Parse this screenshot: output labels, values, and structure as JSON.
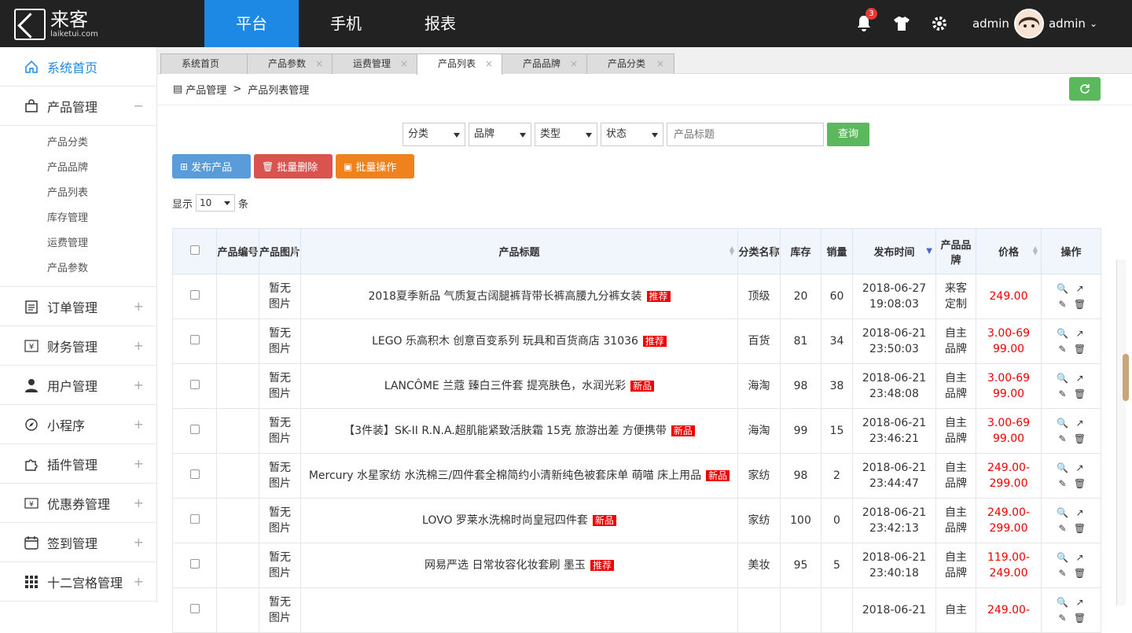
{
  "brand": {
    "cn": "来客",
    "en": "laiketui.com"
  },
  "nav": [
    "平台",
    "手机",
    "报表"
  ],
  "topright": {
    "badge": "3",
    "user_left": "admin",
    "user_right": "admin"
  },
  "sidebar": {
    "home": "系统首页",
    "product": "产品管理",
    "sub": [
      "产品分类",
      "产品品牌",
      "产品列表",
      "库存管理",
      "运费管理",
      "产品参数"
    ],
    "items": [
      "订单管理",
      "财务管理",
      "用户管理",
      "小程序",
      "插件管理",
      "优惠券管理",
      "签到管理",
      "十二宫格管理"
    ]
  },
  "tabs": [
    "系统首页",
    "产品参数",
    "运费管理",
    "产品列表",
    "产品品牌",
    "产品分类"
  ],
  "breadcrumb": {
    "a": "产品管理",
    "sep": ">",
    "b": "产品列表管理"
  },
  "filters": {
    "cat": "分类",
    "brand": "品牌",
    "type": "类型",
    "status": "状态",
    "title_placeholder": "产品标题",
    "query": "查询"
  },
  "actions": {
    "publish": "发布产品",
    "del": "批量删除",
    "batch": "批量操作"
  },
  "show": {
    "pre": "显示",
    "value": "10",
    "post": "条"
  },
  "headers": [
    "产品编号",
    "产品图片",
    "产品标题",
    "分类名称",
    "库存",
    "销量",
    "发布时间",
    "产品品牌",
    "价格",
    "操作"
  ],
  "rows": [
    {
      "img": "暂无图片",
      "title": "2018夏季新品 气质复古阔腿裤背带长裤高腰九分裤女装",
      "tag": "推荐",
      "cat": "顶级",
      "stock": "20",
      "sales": "60",
      "date": "2018-06-27",
      "time": "19:08:03",
      "brand": "来客定制",
      "price": "249.00"
    },
    {
      "img": "暂无图片",
      "title": "LEGO 乐高积木 创意百变系列 玩具和百货商店 31036",
      "tag": "推荐",
      "cat": "百货",
      "stock": "81",
      "sales": "34",
      "date": "2018-06-21",
      "time": "23:50:03",
      "brand": "自主品牌",
      "price": "3.00-6999.00"
    },
    {
      "img": "暂无图片",
      "title": "LANCÔME 兰蔻 臻白三件套 提亮肤色，水润光彩",
      "tag": "新品",
      "cat": "海淘",
      "stock": "98",
      "sales": "38",
      "date": "2018-06-21",
      "time": "23:48:08",
      "brand": "自主品牌",
      "price": "3.00-6999.00"
    },
    {
      "img": "暂无图片",
      "title": "【3件装】SK-II R.N.A.超肌能紧致活肤霜 15克 旅游出差 方便携带",
      "tag": "新品",
      "cat": "海淘",
      "stock": "99",
      "sales": "15",
      "date": "2018-06-21",
      "time": "23:46:21",
      "brand": "自主品牌",
      "price": "3.00-6999.00"
    },
    {
      "img": "暂无图片",
      "title": "Mercury 水星家纺 水洗棉三/四件套全棉简约小清新纯色被套床单 萌喵 床上用品",
      "tag": "新品",
      "cat": "家纺",
      "stock": "98",
      "sales": "2",
      "date": "2018-06-21",
      "time": "23:44:47",
      "brand": "自主品牌",
      "price": "249.00-299.00"
    },
    {
      "img": "暂无图片",
      "title": "LOVO 罗莱水洗棉时尚皇冠四件套",
      "tag": "新品",
      "cat": "家纺",
      "stock": "100",
      "sales": "0",
      "date": "2018-06-21",
      "time": "23:42:13",
      "brand": "自主品牌",
      "price": "249.00-299.00"
    },
    {
      "img": "暂无图片",
      "title": "网易严选 日常妆容化妆套刷 墨玉",
      "tag": "推荐",
      "cat": "美妆",
      "stock": "95",
      "sales": "5",
      "date": "2018-06-21",
      "time": "23:40:18",
      "brand": "自主品牌",
      "price": "119.00-249.00"
    },
    {
      "img": "暂无图片",
      "title": "",
      "tag": "",
      "cat": "",
      "stock": "",
      "sales": "",
      "date": "2018-06-21",
      "time": "",
      "brand": "自主",
      "price": "249.00-"
    }
  ],
  "colors": {
    "accent": "#1e88e5",
    "green": "#5cb85c",
    "blue_btn": "#5a9bd9",
    "red_btn": "#d9534f",
    "orange_btn": "#f0821e",
    "price": "#ee0000"
  }
}
